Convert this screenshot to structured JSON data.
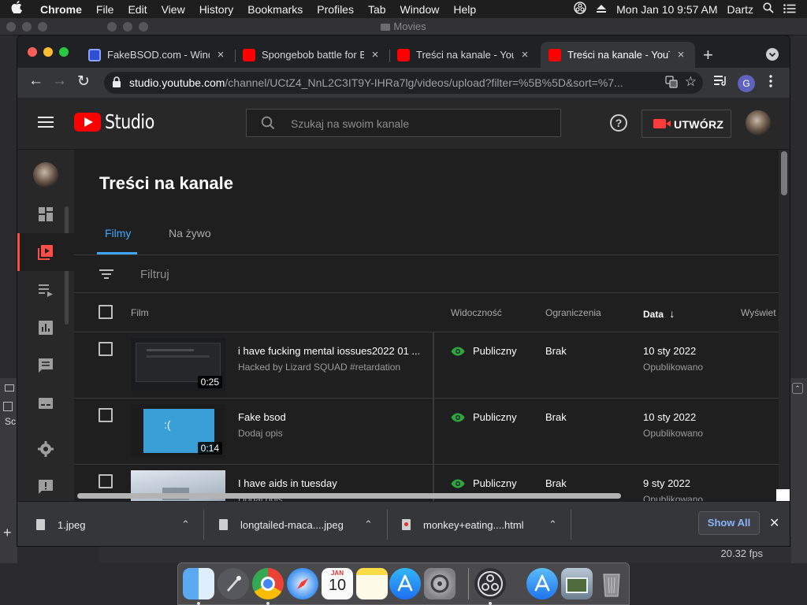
{
  "menubar": {
    "apple": "",
    "app": "Chrome",
    "items": [
      "File",
      "Edit",
      "View",
      "History",
      "Bookmarks",
      "Profiles",
      "Tab",
      "Window",
      "Help"
    ],
    "clock": "Mon Jan 10  9:57 AM",
    "user": "Dartz"
  },
  "background_window": {
    "title": "Movies",
    "fps": "20.32 fps",
    "left_fragment": "Sc"
  },
  "browser": {
    "tabs": [
      {
        "title": "FakeBSOD.com - Windo",
        "favicon": "monitor-icon",
        "active": false
      },
      {
        "title": "Spongebob battle for Bi",
        "favicon": "youtube-icon",
        "active": false
      },
      {
        "title": "Treści na kanale - YouTu",
        "favicon": "youtube-icon",
        "active": false
      },
      {
        "title": "Treści na kanale - YouTu",
        "favicon": "youtube-icon",
        "active": true
      }
    ],
    "url_host": "studio.youtube.com",
    "url_path": "/channel/UCtZ4_NnL2C3IT9Y-IHRa7lg/videos/upload?filter=%5B%5D&sort=%7...",
    "profile_initial": "G"
  },
  "studio": {
    "brand": "Studio",
    "search_placeholder": "Szukaj na swoim kanale",
    "help_glyph": "?",
    "create_label": "UTWÓRZ",
    "page_title": "Treści na kanale",
    "tabs": [
      "Filmy",
      "Na żywo"
    ],
    "filter_placeholder": "Filtruj",
    "columns": {
      "film": "Film",
      "visibility": "Widoczność",
      "restrictions": "Ograniczenia",
      "date": "Data",
      "views": "Wyświet"
    },
    "sort_arrow": "↓",
    "videos": [
      {
        "title": "i have fucking mental iossues2022 01 ...",
        "description": "Hacked by Lizard SQUAD #retardation",
        "duration": "0:25",
        "visibility": "Publiczny",
        "restrictions": "Brak",
        "date": "10 sty 2022",
        "status": "Opublikowano",
        "thumb": "dark"
      },
      {
        "title": "Fake bsod",
        "description": "Dodaj opis",
        "duration": "0:14",
        "visibility": "Publiczny",
        "restrictions": "Brak",
        "date": "10 sty 2022",
        "status": "Opublikowano",
        "thumb": "bsod"
      },
      {
        "title": "I have aids in tuesday",
        "description": "Dodaj opis",
        "duration": "",
        "visibility": "Publiczny",
        "restrictions": "Brak",
        "date": "9 sty 2022",
        "status": "Opublikowano",
        "thumb": "desktop"
      }
    ]
  },
  "downloads": {
    "items": [
      "1.jpeg",
      "longtailed-maca....jpeg",
      "monkey+eating....html"
    ],
    "show_all": "Show All",
    "close": "✕"
  },
  "dock": {
    "apps": [
      "finder-icon",
      "launchpad-icon",
      "chrome-icon",
      "safari-icon",
      "calendar-icon",
      "notes-icon",
      "app-store-icon",
      "system-preferences-icon",
      "obs-icon",
      "downloads-folder-icon",
      "image-folder-icon",
      "trash-icon"
    ],
    "calendar_month": "JAN",
    "calendar_day": "10"
  },
  "colors": {
    "yt_red": "#ff0000",
    "accent_blue": "#3ea6ff",
    "public_green": "#2ba640",
    "show_all_blue": "#8ab4f8"
  }
}
